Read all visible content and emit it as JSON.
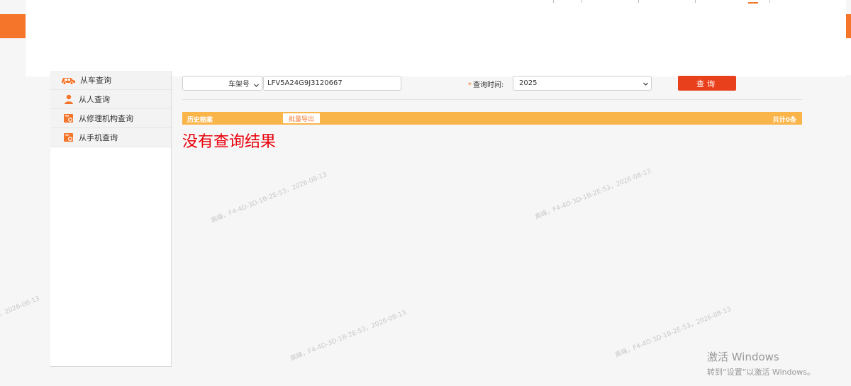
{
  "sidebar": {
    "items": [
      {
        "label": "从车查询",
        "icon": "car-icon"
      },
      {
        "label": "从人查询",
        "icon": "person-icon"
      },
      {
        "label": "从修理机构查询",
        "icon": "wrench-icon"
      },
      {
        "label": "从手机查询",
        "icon": "phone-icon"
      }
    ]
  },
  "query": {
    "type_selected": "车架号",
    "vin_value": "LFV5A24G9J3120667",
    "time_required_mark": "*",
    "time_label": "查询时间:",
    "time_selected": "2025",
    "button_label": "查询"
  },
  "results": {
    "title": "历史赔案",
    "export_label": "批量导出",
    "count_label": "共计0条",
    "empty_message": "没有查询结果"
  },
  "watermark": {
    "text": "高峰，F4-4D-3D-1B-2E-53，2026-08-13"
  },
  "windows_activation": {
    "title": "激活 Windows",
    "subtitle": "转到“设置”以激活 Windows。"
  },
  "colors": {
    "brand_orange": "#f5752a",
    "query_button": "#e8401c",
    "result_bar": "#fab54a",
    "empty_message": "#e8000a"
  }
}
